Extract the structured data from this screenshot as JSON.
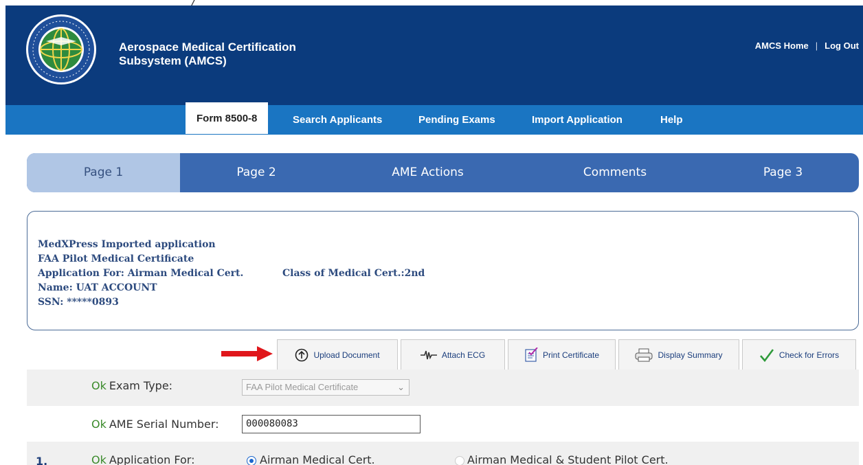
{
  "header": {
    "top_mark": "/",
    "title_line1": "Aerospace Medical Certification",
    "title_line2": "Subsystem (AMCS)",
    "links": [
      "AMCS Home",
      "Log Out"
    ],
    "link_separator": "|"
  },
  "nav": {
    "tabs": [
      {
        "label": "Form 8500-8",
        "active": true
      },
      {
        "label": "Search Applicants",
        "active": false
      },
      {
        "label": "Pending Exams",
        "active": false
      },
      {
        "label": "Import Application",
        "active": false
      },
      {
        "label": "Help",
        "active": false
      }
    ]
  },
  "page_tabs": [
    {
      "label": "Page 1",
      "active": true
    },
    {
      "label": "Page 2",
      "active": false
    },
    {
      "label": "AME Actions",
      "active": false
    },
    {
      "label": "Comments",
      "active": false
    },
    {
      "label": "Page 3",
      "active": false
    }
  ],
  "info": {
    "line1": "MedXPress Imported application",
    "line2": "FAA Pilot Medical Certificate",
    "line3a": "Application For: Airman Medical Cert.",
    "line3b": "Class of Medical Cert.:2nd",
    "line4": "Name: UAT ACCOUNT",
    "line5": "SSN: *****0893"
  },
  "toolbar": {
    "buttons": [
      {
        "label": "Upload Document",
        "icon": "upload-icon"
      },
      {
        "label": "Attach ECG",
        "icon": "ecg-icon"
      },
      {
        "label": "Print Certificate",
        "icon": "print-certificate-icon"
      },
      {
        "label": "Display Summary",
        "icon": "printer-icon"
      },
      {
        "label": "Check for Errors",
        "icon": "checkmark-icon"
      }
    ]
  },
  "form": {
    "ok": "Ok",
    "exam_type_label": "Exam Type:",
    "exam_type_value": "FAA Pilot Medical Certificate",
    "serial_label": "AME Serial Number:",
    "serial_value": "000080083",
    "q1_number": "1.",
    "application_for_label": "Application For:",
    "option1": "Airman Medical Cert.",
    "option2": "Airman Medical & Student Pilot Cert."
  },
  "colors": {
    "header_bg": "#0b3b7d",
    "nav_bg": "#1a75c2",
    "pagebar_bg": "#3a69b1",
    "pagebar_active": "#b0c6e5",
    "ok_green": "#3a8a2a",
    "arrow_red": "#e0161b"
  }
}
